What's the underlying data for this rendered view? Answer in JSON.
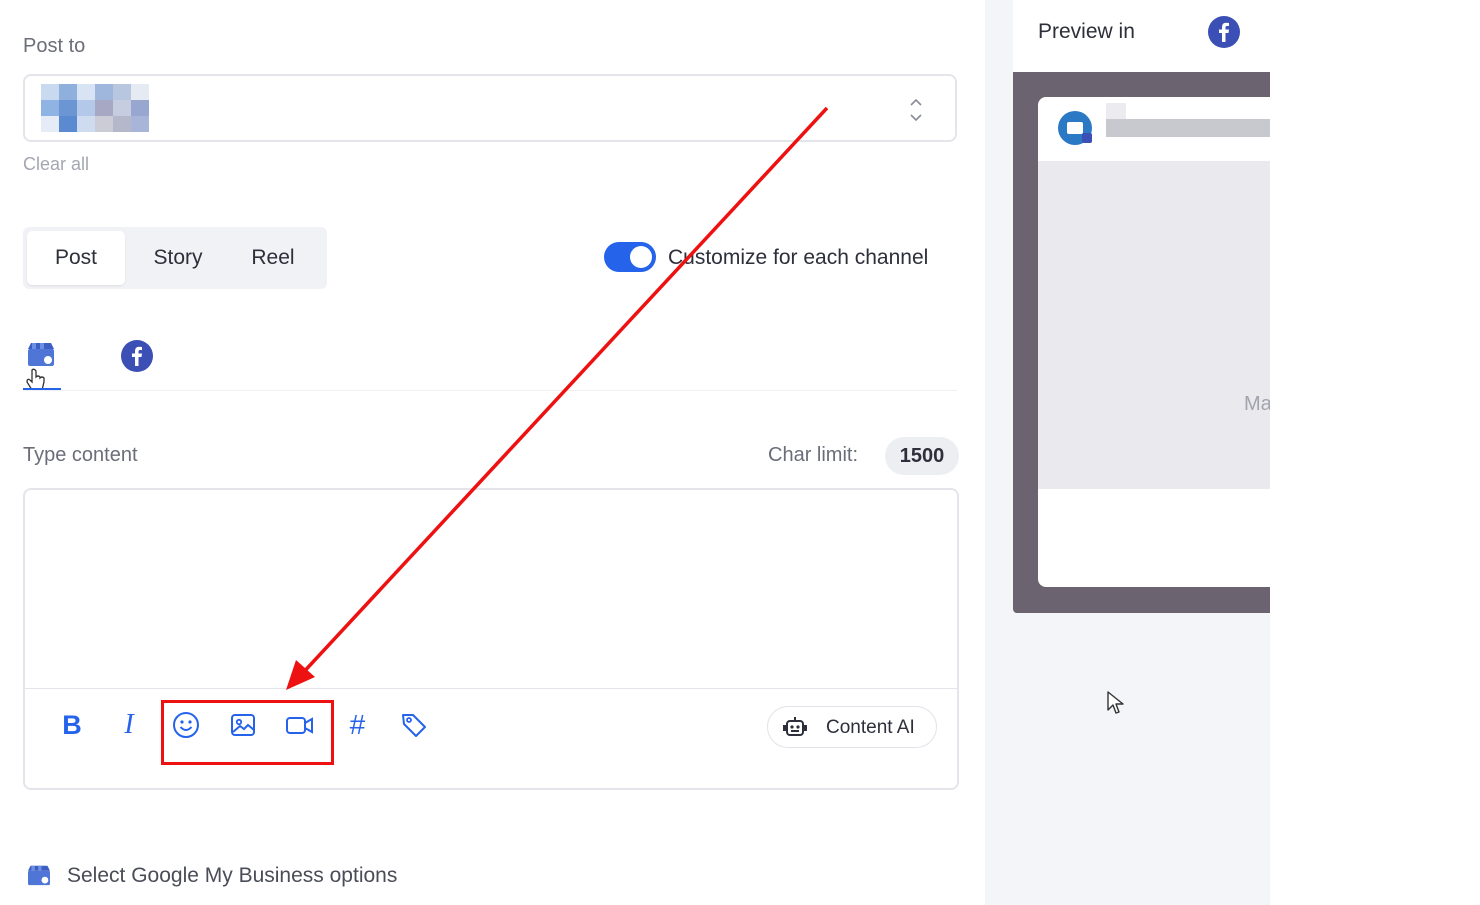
{
  "post_to": {
    "label": "Post to",
    "clear_all": "Clear all"
  },
  "post_types": {
    "tabs": [
      {
        "label": "Post",
        "active": true
      },
      {
        "label": "Story",
        "active": false
      },
      {
        "label": "Reel",
        "active": false
      }
    ]
  },
  "customize_toggle": {
    "label": "Customize for each channel",
    "enabled": true
  },
  "channels": [
    {
      "name": "Google My Business",
      "icon": "gmb-icon",
      "active": true
    },
    {
      "name": "Facebook",
      "icon": "facebook-icon",
      "active": false
    }
  ],
  "content": {
    "label": "Type content",
    "char_limit_label": "Char limit:",
    "char_limit_value": "1500",
    "text": ""
  },
  "toolbar": {
    "tools": [
      "bold-icon",
      "italic-icon",
      "emoji-icon",
      "image-icon",
      "video-icon",
      "hashtag-icon",
      "tag-icon"
    ],
    "content_ai_label": "Content AI"
  },
  "gmb_options": {
    "label": "Select Google My Business options"
  },
  "preview": {
    "title": "Preview in",
    "media_text": "Ma"
  },
  "colors": {
    "accent": "#2563eb",
    "facebook": "#3b4fb5",
    "annotation": "#ee1111",
    "preview_frame": "#6b6370"
  }
}
